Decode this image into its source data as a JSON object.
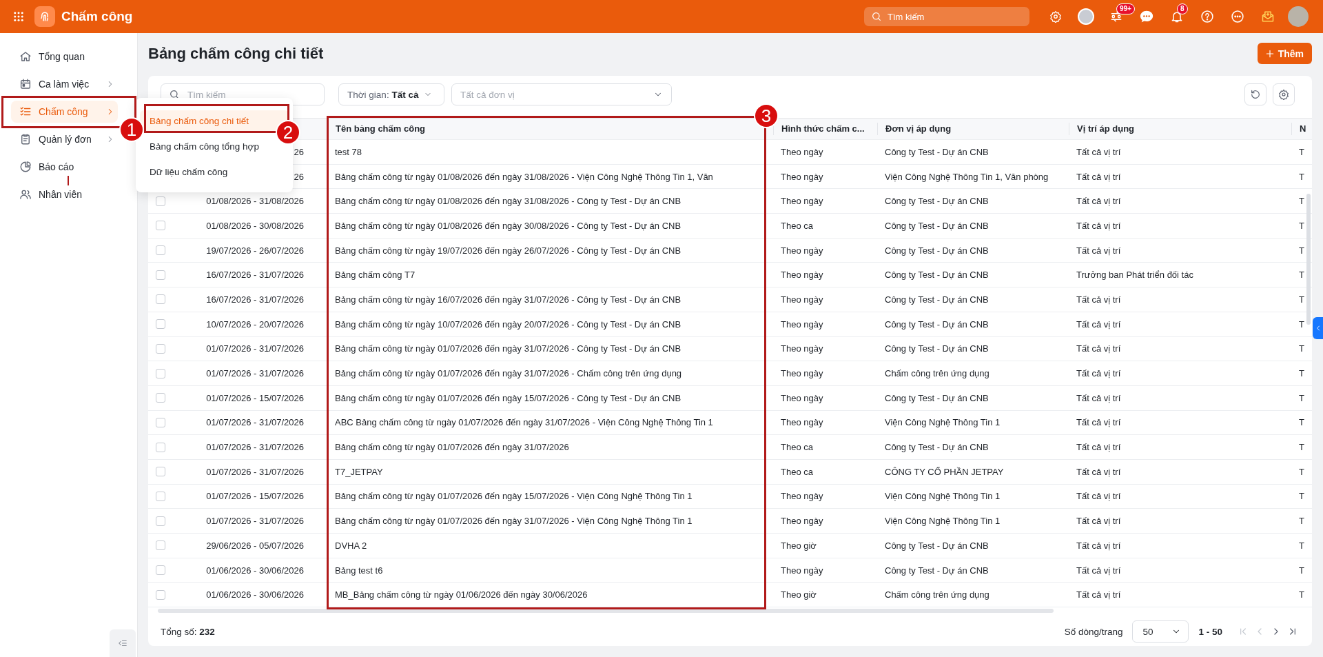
{
  "app": {
    "title": "Chấm công"
  },
  "topbar": {
    "search": {
      "placeholder": "Tìm kiếm"
    },
    "requests_badge": "99+",
    "notifications_badge": "8"
  },
  "sidebar": {
    "items": [
      {
        "label": "Tổng quan",
        "has_submenu": false,
        "selected": false
      },
      {
        "label": "Ca làm việc",
        "has_submenu": true,
        "selected": false
      },
      {
        "label": "Chấm công",
        "has_submenu": true,
        "selected": true
      },
      {
        "label": "Quản lý đơn",
        "has_submenu": true,
        "selected": false
      },
      {
        "label": "Báo cáo",
        "has_submenu": false,
        "selected": false
      },
      {
        "label": "Nhân viên",
        "has_submenu": false,
        "selected": false
      }
    ]
  },
  "submenu": {
    "items": [
      {
        "label": "Bảng chấm công chi tiết",
        "selected": true
      },
      {
        "label": "Bảng chấm công tổng hợp",
        "selected": false
      },
      {
        "label": "Dữ liệu chấm công",
        "selected": false
      }
    ]
  },
  "page": {
    "title": "Bảng chấm công chi tiết",
    "add_button": "Thêm"
  },
  "filters": {
    "search": {
      "placeholder": "Tìm kiếm"
    },
    "time_label": "Thời gian:",
    "time_value": "Tất cả",
    "unit": {
      "placeholder": "Tất cả đơn vị"
    }
  },
  "table": {
    "columns": [
      "Tên bảng chấm công",
      "Hình thức chấm c...",
      "Đơn vị áp dụng",
      "Vị trí áp dụng",
      "N"
    ],
    "rows": [
      {
        "period": "26",
        "name": "test 78",
        "method": "Theo ngày",
        "unit": "Công ty Test - Dự án CNB",
        "position": "Tất cả vị trí",
        "column_7": "T"
      },
      {
        "period": "26",
        "name": "Bảng chấm công từ ngày 01/08/2026 đến ngày 31/08/2026 - Viện Công Nghệ Thông Tin 1, Văn",
        "method": "Theo ngày",
        "unit": "Viện Công Nghệ Thông Tin 1, Văn phòng",
        "position": "Tất cả vị trí",
        "column_7": "T"
      },
      {
        "checked": false,
        "period": "01/08/2026 - 31/08/2026",
        "name": "Bảng chấm công từ ngày 01/08/2026 đến ngày 31/08/2026 - Công ty Test - Dự án CNB",
        "method": "Theo ngày",
        "unit": "Công ty Test - Dự án CNB",
        "position": "Tất cả vị trí",
        "column_7": "T"
      },
      {
        "checked": false,
        "period": "01/08/2026 - 30/08/2026",
        "name": "Bảng chấm công từ ngày 01/08/2026 đến ngày 30/08/2026 - Công ty Test - Dự án CNB",
        "method": "Theo ca",
        "unit": "Công ty Test - Dự án CNB",
        "position": "Tất cả vị trí",
        "column_7": "T"
      },
      {
        "checked": false,
        "period": "19/07/2026 - 26/07/2026",
        "name": "Bảng chấm công từ ngày 19/07/2026 đến ngày 26/07/2026 - Công ty Test - Dự án CNB",
        "method": "Theo ngày",
        "unit": "Công ty Test - Dự án CNB",
        "position": "Tất cả vị trí",
        "column_7": "T"
      },
      {
        "checked": false,
        "period": "16/07/2026 - 31/07/2026",
        "name": "Bảng chấm công T7",
        "method": "Theo ngày",
        "unit": "Công ty Test - Dự án CNB",
        "position": "Trưởng ban Phát triển đối tác",
        "column_7": "T"
      },
      {
        "checked": false,
        "period": "16/07/2026 - 31/07/2026",
        "name": "Bảng chấm công từ ngày 16/07/2026 đến ngày 31/07/2026 - Công ty Test - Dự án CNB",
        "method": "Theo ngày",
        "unit": "Công ty Test - Dự án CNB",
        "position": "Tất cả vị trí",
        "column_7": "T"
      },
      {
        "checked": false,
        "period": "10/07/2026 - 20/07/2026",
        "name": "Bảng chấm công từ ngày 10/07/2026 đến ngày 20/07/2026 - Công ty Test - Dự án CNB",
        "method": "Theo ngày",
        "unit": "Công ty Test - Dự án CNB",
        "position": "Tất cả vị trí",
        "column_7": "T"
      },
      {
        "checked": false,
        "period": "01/07/2026 - 31/07/2026",
        "name": "Bảng chấm công từ ngày 01/07/2026 đến ngày 31/07/2026 - Công ty Test - Dự án CNB",
        "method": "Theo ngày",
        "unit": "Công ty Test - Dự án CNB",
        "position": "Tất cả vị trí",
        "column_7": "T"
      },
      {
        "checked": false,
        "period": "01/07/2026 - 31/07/2026",
        "name": "Bảng chấm công từ ngày 01/07/2026 đến ngày 31/07/2026 - Chấm công trên ứng dụng",
        "method": "Theo ngày",
        "unit": "Chấm công trên ứng dụng",
        "position": "Tất cả vị trí",
        "column_7": "T"
      },
      {
        "checked": false,
        "period": "01/07/2026 - 15/07/2026",
        "name": "Bảng chấm công từ ngày 01/07/2026 đến ngày 15/07/2026 - Công ty Test - Dự án CNB",
        "method": "Theo ngày",
        "unit": "Công ty Test - Dự án CNB",
        "position": "Tất cả vị trí",
        "column_7": "T"
      },
      {
        "checked": false,
        "period": "01/07/2026 - 31/07/2026",
        "name": "ABC Bảng chấm công từ ngày 01/07/2026 đến ngày 31/07/2026 - Viện Công Nghệ Thông Tin 1",
        "method": "Theo ngày",
        "unit": "Viện Công Nghệ Thông Tin 1",
        "position": "Tất cả vị trí",
        "column_7": "T"
      },
      {
        "checked": false,
        "period": "01/07/2026 - 31/07/2026",
        "name": "Bảng chấm công từ ngày 01/07/2026 đến ngày 31/07/2026",
        "method": "Theo ca",
        "unit": "Công ty Test - Dự án CNB",
        "position": "Tất cả vị trí",
        "column_7": "T"
      },
      {
        "checked": false,
        "period": "01/07/2026 - 31/07/2026",
        "name": "T7_JETPAY",
        "method": "Theo ca",
        "unit": "CÔNG TY CỔ PHẦN JETPAY",
        "position": "Tất cả vị trí",
        "column_7": "T"
      },
      {
        "checked": false,
        "period": "01/07/2026 - 15/07/2026",
        "name": "Bảng chấm công từ ngày 01/07/2026 đến ngày 15/07/2026 - Viện Công Nghệ Thông Tin 1",
        "method": "Theo ngày",
        "unit": "Viện Công Nghệ Thông Tin 1",
        "position": "Tất cả vị trí",
        "column_7": "T"
      },
      {
        "checked": false,
        "period": "01/07/2026 - 31/07/2026",
        "name": "Bảng chấm công từ ngày 01/07/2026 đến ngày 31/07/2026 - Viện Công Nghệ Thông Tin 1",
        "method": "Theo ngày",
        "unit": "Viện Công Nghệ Thông Tin 1",
        "position": "Tất cả vị trí",
        "column_7": "T"
      },
      {
        "checked": false,
        "period": "29/06/2026 - 05/07/2026",
        "name": "DVHA 2",
        "method": "Theo giờ",
        "unit": "Công ty Test - Dự án CNB",
        "position": "Tất cả vị trí",
        "column_7": "T"
      },
      {
        "checked": false,
        "period": "01/06/2026 - 30/06/2026",
        "name": "Bảng test t6",
        "method": "Theo ngày",
        "unit": "Công ty Test - Dự án CNB",
        "position": "Tất cả vị trí",
        "column_7": "T"
      },
      {
        "checked": false,
        "period": "01/06/2026 - 30/06/2026",
        "name": "MB_Bảng chấm công từ ngày 01/06/2026 đến ngày 30/06/2026",
        "method": "Theo giờ",
        "unit": "Chấm công trên ứng dụng",
        "position": "Tất cả vị trí",
        "column_7": "T"
      }
    ]
  },
  "footer": {
    "total_label": "Tổng số:",
    "total": "232",
    "page_size_label": "Số dòng/trang",
    "page_size": "50",
    "range": "1 - 50"
  },
  "annotations": [
    {
      "label": "1"
    },
    {
      "label": "2"
    },
    {
      "label": "3"
    }
  ]
}
